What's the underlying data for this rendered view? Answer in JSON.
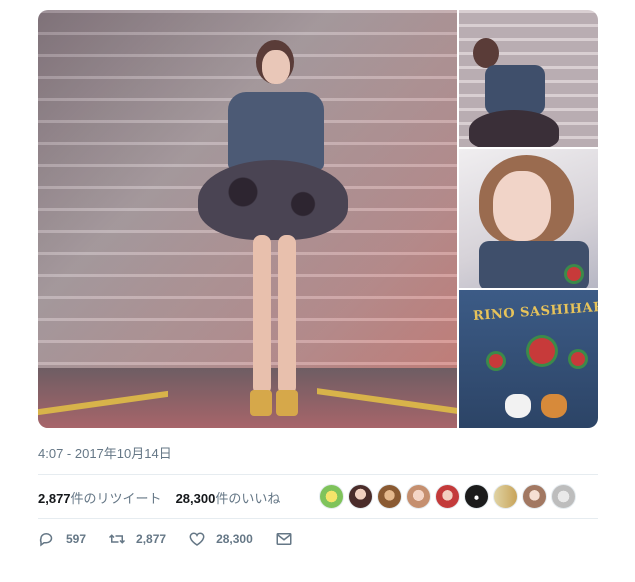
{
  "tweet": {
    "timestamp": "4:07 - 2017年10月14日",
    "banner_text": "RINO SASHIHARA",
    "stats": {
      "retweets_count": "2,877",
      "retweets_label": "件のリツイート",
      "likes_count": "28,300",
      "likes_label": "件のいいね"
    },
    "actions": {
      "reply_count": "597",
      "retweet_count": "2,877",
      "like_count": "28,300"
    },
    "colors": {
      "muted_text": "#657786",
      "primary_text": "#14171a",
      "divider": "#e6ecf0"
    },
    "icons": {
      "reply": "reply-icon",
      "retweet": "retweet-icon",
      "like": "heart-icon",
      "dm": "envelope-icon"
    }
  }
}
